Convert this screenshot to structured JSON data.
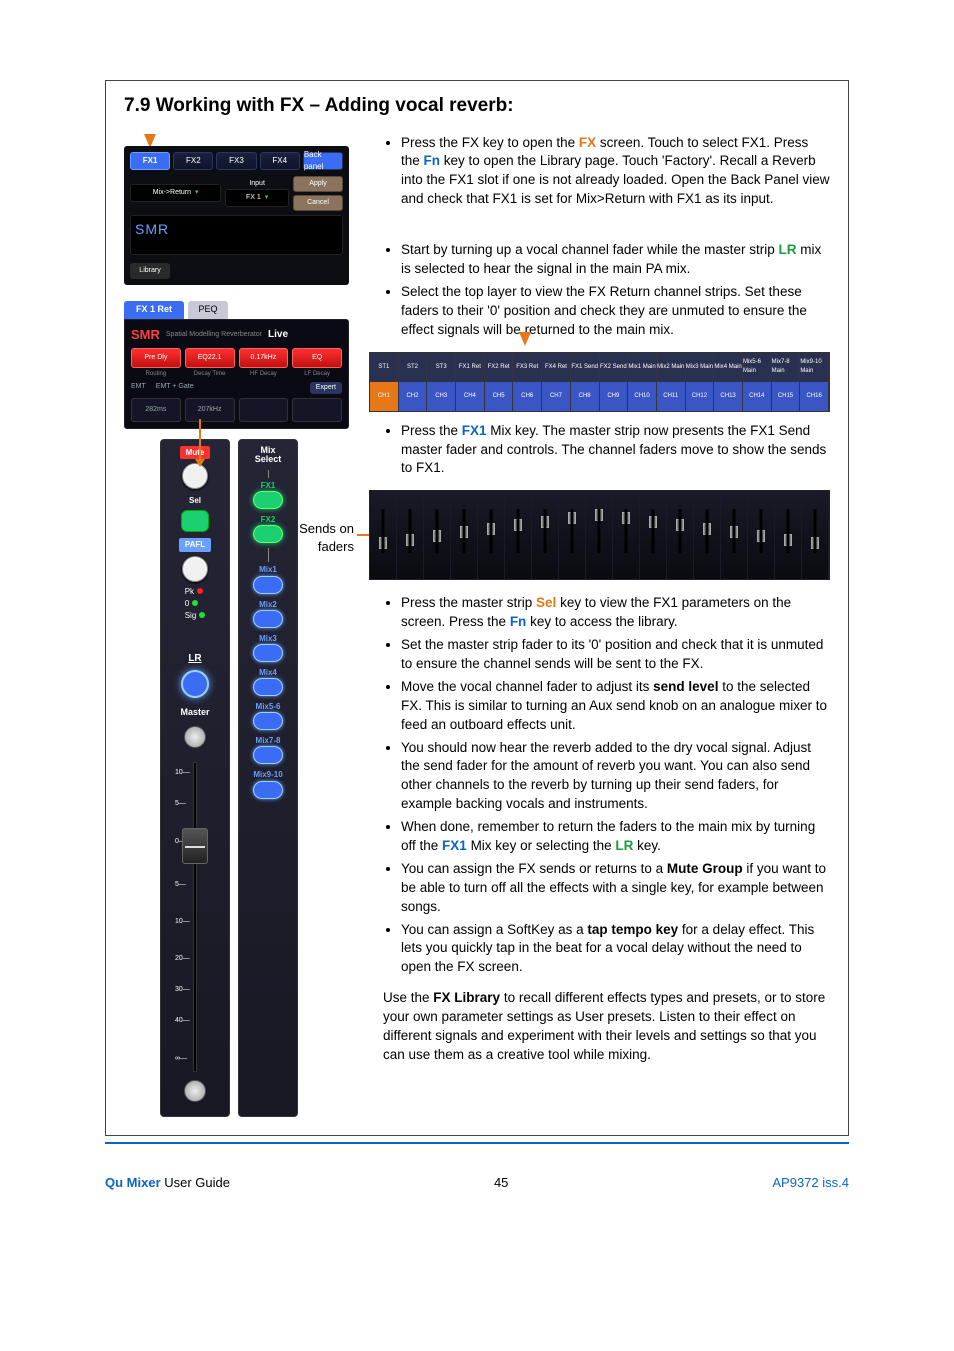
{
  "section_title": "7.9  Working with FX – Adding vocal reverb:",
  "fx_panel": {
    "tabs": [
      "FX1",
      "FX2",
      "FX3",
      "FX4",
      "Back panel"
    ],
    "mix_return": "Mix->Return",
    "input_label": "Input",
    "input_value": "FX 1",
    "apply": "Apply",
    "cancel": "Cancel",
    "smr": "SMR",
    "library": "Library"
  },
  "fx_params": {
    "fx1_ret": "FX 1 Ret",
    "peq": "PEQ",
    "smr": "SMR",
    "live": "Live",
    "live_btns": [
      "Pre Dly",
      "EQ22.1",
      "0.17kHz",
      "EQ"
    ],
    "live_btns2": [
      "Routing",
      "Decay Time",
      "HF Decay",
      "LF Decay"
    ],
    "emt": "EMT",
    "emt_gate": "EMT + Gate",
    "expert": "Expert",
    "dec": "282ms",
    "dec2": "207kHz"
  },
  "strip": {
    "mute": "Mute",
    "sel": "Sel",
    "pafl": "PAFL",
    "pk": "Pk",
    "zero": "0",
    "sig": "Sig",
    "lr": "LR",
    "master": "Master",
    "mix_select": "Mix\nSelect",
    "mix_btns": [
      "FX1",
      "FX2",
      "Mix1",
      "Mix2",
      "Mix3",
      "Mix4",
      "Mix5-6",
      "Mix7-8",
      "Mix9-10"
    ],
    "db_marks": [
      "10",
      "5",
      "0",
      "5",
      "10",
      "20",
      "30",
      "40",
      "∞"
    ]
  },
  "layers": {
    "top": [
      "ST1",
      "ST2",
      "ST3",
      "FX1 Ret",
      "FX2 Ret",
      "FX3 Ret",
      "FX4 Ret",
      "FX1 Send",
      "FX2 Send",
      "Mix1 Main",
      "Mix2 Main",
      "Mix3 Main",
      "Mix4 Main",
      "Mix5-6 Main",
      "Mix7-8 Main",
      "Mix9-10 Main"
    ],
    "bot": [
      "CH1",
      "CH2",
      "CH3",
      "CH4",
      "CH5",
      "CH6",
      "CH7",
      "CH8",
      "CH9",
      "CH10",
      "CH11",
      "CH12",
      "CH13",
      "CH14",
      "CH15",
      "CH16"
    ]
  },
  "sends_label": "Sends on faders",
  "bullets_block1": [
    {
      "pre": "Press the FX key to open the ",
      "hl1": "FX",
      "hl1c": "fx-orange",
      "mid1": " screen. Touch to select FX1. Press the ",
      "hl2": "Fn",
      "hl2c": "fx-blue",
      "post": " key to open the Library page. Touch 'Factory'. Recall a Reverb into the FX1 slot if one is not already loaded. Open the Back Panel view and check that FX1 is set for Mix>Return with FX1 as its input."
    }
  ],
  "bullets_block2": [
    {
      "pre": "Start by turning up a vocal channel fader while the master strip ",
      "hl1": "LR",
      "hl1c": "fx-green",
      "post": " mix is selected to hear the signal in the main PA mix."
    },
    {
      "plain": "Select the top layer to view the FX Return channel strips. Set these faders to their '0' position and check they are unmuted to ensure the effect signals will be returned to the main mix."
    }
  ],
  "bullets_block3": [
    {
      "pre": "Press the ",
      "hl1": "FX1",
      "hl1c": "fx-blue",
      "post": " Mix key. The master strip now presents the FX1 Send master fader and controls. The channel faders move to show the sends to FX1."
    }
  ],
  "bullets_block4": [
    {
      "pre": "Press the master strip ",
      "hl1": "Sel",
      "hl1c": "fx-orange",
      "mid1": " key to view the FX1 parameters on the screen. Press the ",
      "hl2": "Fn",
      "hl2c": "fx-blue",
      "post": " key to access the library."
    },
    {
      "plain": "Set the master strip fader to its '0' position and check that it is unmuted to ensure the channel sends will be sent to the FX."
    },
    {
      "pre": "Move the vocal channel fader to adjust its ",
      "b1": "send level",
      "post": " to the selected FX. This is similar to turning an Aux send knob on an analogue mixer to feed an outboard effects unit."
    },
    {
      "plain": "You should now hear the reverb added to the dry vocal signal. Adjust the send fader for the amount of reverb you want. You can also send other channels to the reverb by turning up their send faders, for example backing vocals and instruments."
    },
    {
      "pre": "When done, remember to return the faders to the main mix by turning off the ",
      "hl1": "FX1",
      "hl1c": "fx-blue",
      "mid1": " Mix key or selecting the ",
      "hl2": "LR",
      "hl2c": "fx-green",
      "post": " key."
    },
    {
      "pre": "You can assign the FX sends or returns to a ",
      "b1": "Mute Group",
      "post": " if you want to be able to turn off all the effects with a single key, for example between songs."
    },
    {
      "pre": "You can assign a SoftKey as a ",
      "b1": "tap tempo key",
      "post": " for a delay effect. This lets you quickly tap in the beat for a vocal delay without the need to open the FX screen."
    }
  ],
  "closing": {
    "pre": "Use the ",
    "b1": "FX Library",
    "post": " to recall different effects types and presets, or to store your own parameter settings as User presets. Listen to their effect on different signals and experiment with their levels and settings so that you can use them as a creative tool while mixing."
  },
  "footer": {
    "brand": "Qu Mixer",
    "guide": " User Guide",
    "page": "45",
    "code": "AP9372 iss.4"
  }
}
